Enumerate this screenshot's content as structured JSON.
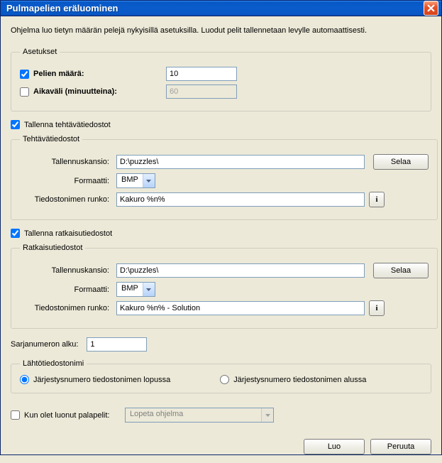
{
  "window": {
    "title": "Pulmapelien eräluominen"
  },
  "description": "Ohjelma luo tietyn määrän pelejä nykyisillä asetuksilla. Luodut pelit tallennetaan levylle automaattisesti.",
  "settings": {
    "legend": "Asetukset",
    "games_count": {
      "label": "Pelien määrä:",
      "value": "10",
      "checked": true
    },
    "interval": {
      "label": "Aikaväli (minuutteina):",
      "value": "60",
      "checked": false
    }
  },
  "save_task": {
    "label": "Tallenna tehtävätiedostot",
    "checked": true
  },
  "task_files": {
    "legend": "Tehtävätiedostot",
    "folder_label": "Tallennuskansio:",
    "folder_value": "D:\\puzzles\\",
    "browse": "Selaa",
    "format_label": "Formaatti:",
    "format_value": "BMP",
    "stem_label": "Tiedostonimen runko:",
    "stem_value": "Kakuro %n%",
    "info": "i"
  },
  "save_solution": {
    "label": "Tallenna ratkaisutiedostot",
    "checked": true
  },
  "solution_files": {
    "legend": "Ratkaisutiedostot",
    "folder_label": "Tallennuskansio:",
    "folder_value": "D:\\puzzles\\",
    "browse": "Selaa",
    "format_label": "Formaatti:",
    "format_value": "BMP",
    "stem_label": "Tiedostonimen runko:",
    "stem_value": "Kakuro %n% - Solution",
    "info": "i"
  },
  "serial": {
    "label": "Sarjanumeron alku:",
    "value": "1"
  },
  "output_name": {
    "legend": "Lähtötiedostonimi",
    "opt_suffix": "Järjestysnumero tiedostonimen lopussa",
    "opt_prefix": "Järjestysnumero tiedostonimen alussa"
  },
  "after_create": {
    "label": "Kun olet luonut palapelit:",
    "selected": "Lopeta ohjelma",
    "checked": false
  },
  "buttons": {
    "create": "Luo",
    "cancel": "Peruuta"
  }
}
